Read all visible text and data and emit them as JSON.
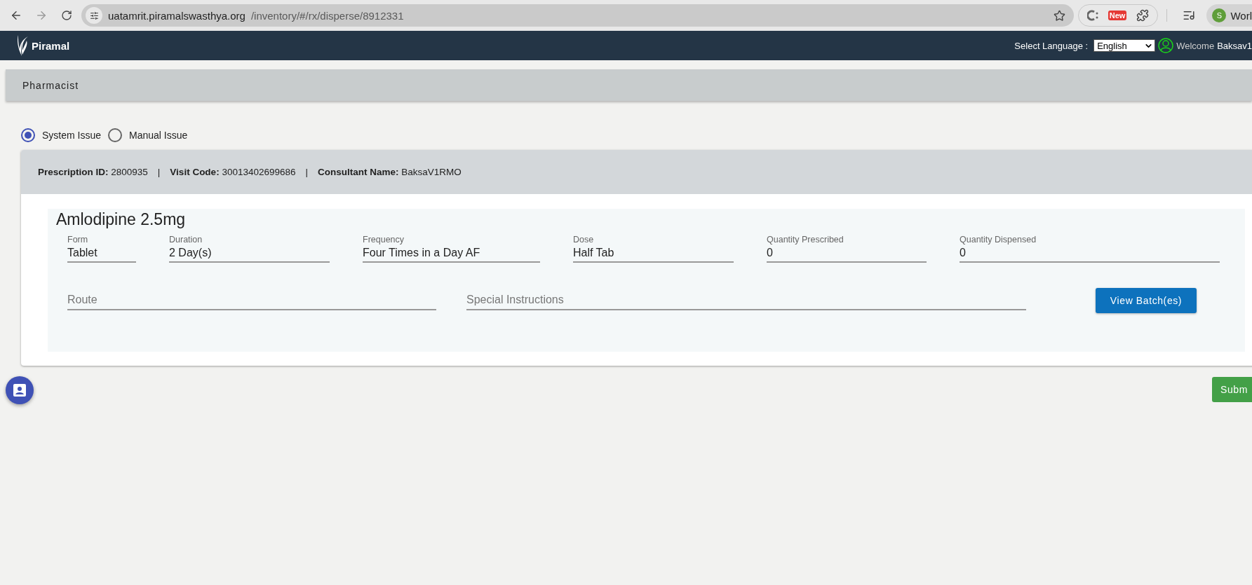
{
  "browser": {
    "url_host": "uatamrit.piramalswasthya.org",
    "url_path": "/inventory/#/rx/disperse/8912331",
    "extension_badge": "New",
    "profile_initial": "S",
    "profile_label": "Worl"
  },
  "header": {
    "brand": "Piramal",
    "language_label": "Select Language :",
    "language": "English",
    "welcome": "Welcome",
    "user": "Baksav1"
  },
  "section_title": "Pharmacist",
  "issue_modes": [
    {
      "label": "System Issue",
      "selected": true
    },
    {
      "label": "Manual Issue",
      "selected": false
    }
  ],
  "prescription": {
    "expanded": true,
    "separator": "|",
    "details": [
      "**Prescription ID:** 2800935",
      "**Visit Code:** 30013402699686",
      "**Consultant Name:** BaksaV1RMO"
    ],
    "medicine": {
      "name": "Amlodipine 2.5mg",
      "fields": [
        {
          "label": "Form",
          "value": "Tablet"
        },
        {
          "label": "Duration",
          "value": "2 Day(s)"
        },
        {
          "label": "Frequency",
          "value": "Four Times in a Day AF"
        },
        {
          "label": "Dose",
          "value": "Half Tab"
        },
        {
          "label": "Quantity Prescribed",
          "value": "0"
        },
        {
          "label": "Quantity Dispensed",
          "value": "0"
        }
      ],
      "inputs": [
        {
          "placeholder": "Route"
        },
        {
          "placeholder": "Special Instructions"
        }
      ],
      "action": "View Batch(es)"
    }
  },
  "submit": "Subm"
}
